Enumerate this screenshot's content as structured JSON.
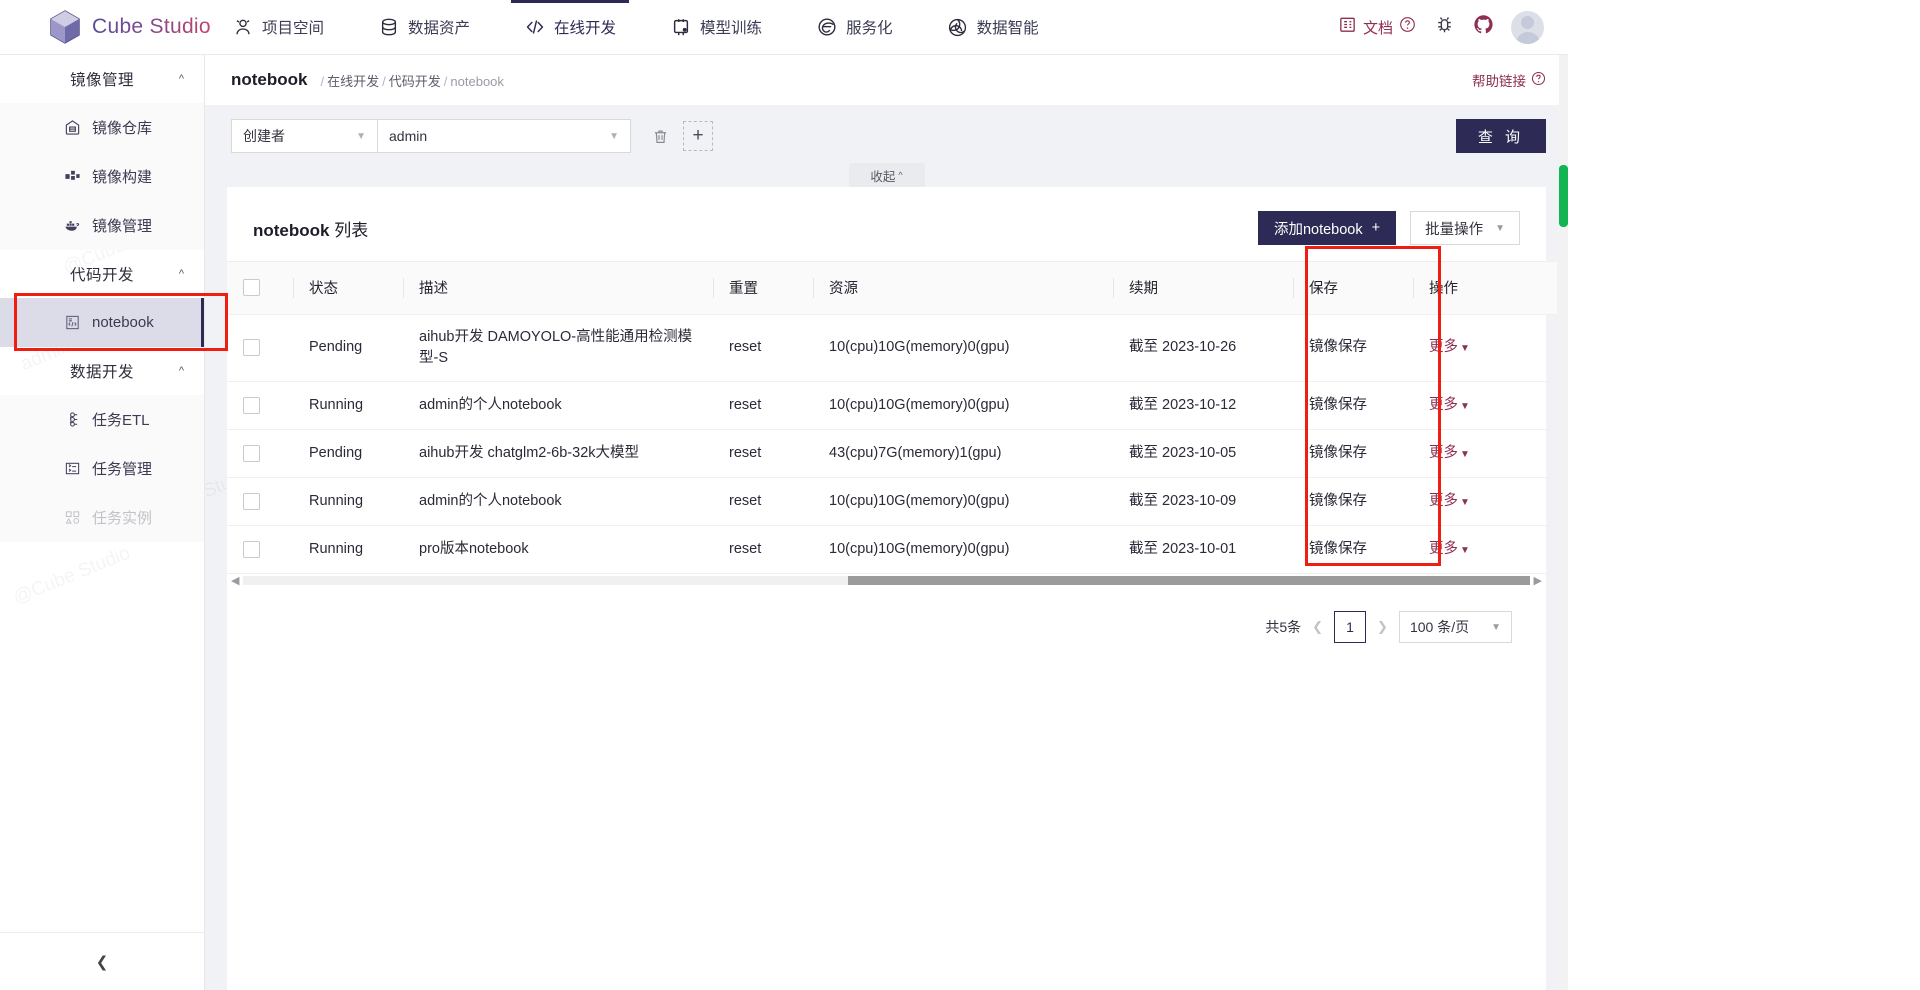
{
  "app": {
    "brand": "Cube Studio"
  },
  "topnav": {
    "items": [
      {
        "label": "项目空间",
        "icon": "users-icon",
        "active": false
      },
      {
        "label": "数据资产",
        "icon": "database-icon",
        "active": false
      },
      {
        "label": "在线开发",
        "icon": "code-icon",
        "active": true
      },
      {
        "label": "模型训练",
        "icon": "flask-icon",
        "active": false
      },
      {
        "label": "服务化",
        "icon": "edge-icon",
        "active": false
      },
      {
        "label": "数据智能",
        "icon": "openai-icon",
        "active": false
      }
    ],
    "right": {
      "docs_label": "文档",
      "docs_icon": "building-icon",
      "help_icon": "question-circle-icon",
      "bug_icon": "bug-icon",
      "github_icon": "github-icon",
      "avatar_icon": "avatar"
    }
  },
  "sidebar": {
    "groups": [
      {
        "title": "镜像管理",
        "caret": "chevron-up-icon",
        "items": [
          {
            "label": "镜像仓库",
            "icon": "repo-icon",
            "active": false,
            "disabled": false
          },
          {
            "label": "镜像构建",
            "icon": "build-icon",
            "active": false,
            "disabled": false
          },
          {
            "label": "镜像管理",
            "icon": "docker-icon",
            "active": false,
            "disabled": false
          }
        ]
      },
      {
        "title": "代码开发",
        "caret": "chevron-up-icon",
        "items": [
          {
            "label": "notebook",
            "icon": "notebook-icon",
            "active": true,
            "disabled": false
          }
        ]
      },
      {
        "title": "数据开发",
        "caret": "chevron-up-icon",
        "items": [
          {
            "label": "任务ETL",
            "icon": "etl-icon",
            "active": false,
            "disabled": false
          },
          {
            "label": "任务管理",
            "icon": "task-icon",
            "active": false,
            "disabled": false
          },
          {
            "label": "任务实例",
            "icon": "instance-icon",
            "active": false,
            "disabled": true
          }
        ]
      }
    ],
    "collapse_icon": "chevron-left-icon"
  },
  "breadcrumb": {
    "title": "notebook",
    "segments": [
      "在线开发",
      "代码开发"
    ],
    "last": "notebook",
    "help_label": "帮助链接",
    "help_icon": "question-circle-icon"
  },
  "filters": {
    "field_label": "创建者",
    "field_caret": "chevron-down-icon",
    "value": "admin",
    "value_caret": "chevron-down-icon",
    "delete_icon": "trash-icon",
    "add_icon": "plus-icon",
    "query_label": "查 询",
    "collapse_label": "收起",
    "collapse_caret": "chevron-up-icon"
  },
  "panel": {
    "title_main": "notebook",
    "title_sub": " 列表",
    "add_label": "添加notebook",
    "add_icon": "plus-icon",
    "batch_label": "批量操作",
    "batch_caret": "chevron-down-icon"
  },
  "table": {
    "columns": [
      "状态",
      "描述",
      "重置",
      "资源",
      "续期",
      "保存",
      "操作"
    ],
    "select_all_icon": "checkbox",
    "rows": [
      {
        "status": "Pending",
        "desc": "aihub开发 DAMOYOLO-高性能通用检测模型-S",
        "reset": "reset",
        "resource": "10(cpu)10G(memory)0(gpu)",
        "renew": "截至 2023-10-26",
        "save": "镜像保存",
        "more": "更多"
      },
      {
        "status": "Running",
        "desc": "admin的个人notebook",
        "reset": "reset",
        "resource": "10(cpu)10G(memory)0(gpu)",
        "renew": "截至 2023-10-12",
        "save": "镜像保存",
        "more": "更多"
      },
      {
        "status": "Pending",
        "desc": "aihub开发 chatglm2-6b-32k大模型",
        "reset": "reset",
        "resource": "43(cpu)7G(memory)1(gpu)",
        "renew": "截至 2023-10-05",
        "save": "镜像保存",
        "more": "更多"
      },
      {
        "status": "Running",
        "desc": "admin的个人notebook",
        "reset": "reset",
        "resource": "10(cpu)10G(memory)0(gpu)",
        "renew": "截至 2023-10-09",
        "save": "镜像保存",
        "more": "更多"
      },
      {
        "status": "Running",
        "desc": "pro版本notebook",
        "reset": "reset",
        "resource": "10(cpu)10G(memory)0(gpu)",
        "renew": "截至 2023-10-01",
        "save": "镜像保存",
        "more": "更多"
      }
    ]
  },
  "pagination": {
    "total": "共5条",
    "prev_icon": "chevron-left-icon",
    "next_icon": "chevron-right-icon",
    "current_page": "1",
    "page_size": "100 条/页",
    "page_size_caret": "chevron-down-icon"
  },
  "watermark": {
    "text_a": "admin",
    "text_b": "@Cube Studio"
  },
  "colors": {
    "brand_dark": "#2d2b55",
    "accent_red": "#8e2e52",
    "status_green": "#3f8b3f",
    "highlight_box": "#ef1d12"
  }
}
